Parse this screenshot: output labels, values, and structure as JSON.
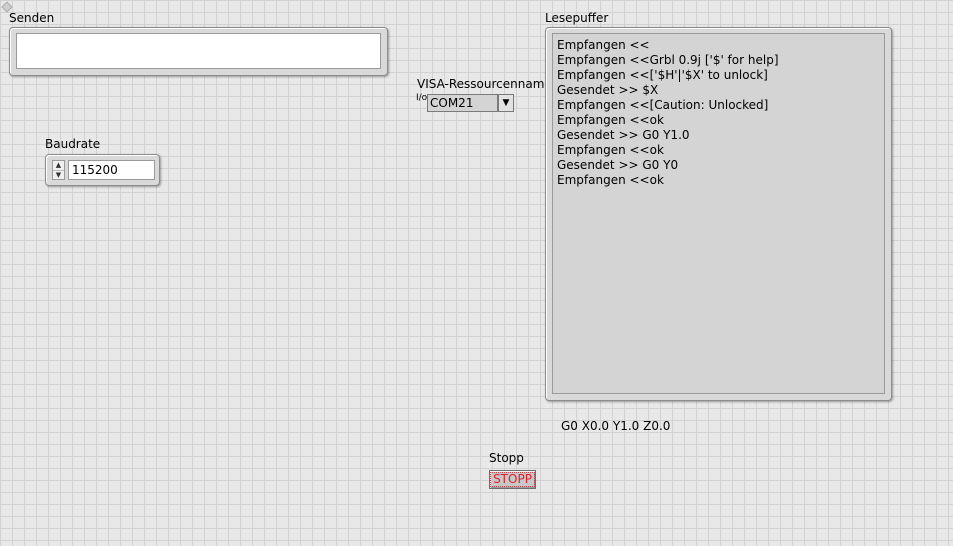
{
  "senden": {
    "label": "Senden",
    "value": ""
  },
  "lesepuffer": {
    "label": "Lesepuffer",
    "lines": [
      "Empfangen <<",
      "Empfangen <<Grbl 0.9j ['$' for help]",
      "Empfangen <<['$H'|'$X' to unlock]",
      "Gesendet >> $X",
      "Empfangen <<[Caution: Unlocked]",
      "Empfangen <<ok",
      "Gesendet >> G0 Y1.0",
      "Empfangen <<ok",
      "Gesendet >> G0 Y0",
      "Empfangen <<ok"
    ]
  },
  "visa": {
    "label": "VISA-Ressourcenname",
    "icon_glyph": "I/o",
    "value": "COM21",
    "arrow_glyph": "▼"
  },
  "baudrate": {
    "label": "Baudrate",
    "value": "115200",
    "up_glyph": "▲",
    "down_glyph": "▼"
  },
  "position_readout": "G0 X0.0 Y1.0 Z0.0",
  "stopp": {
    "label": "Stopp",
    "button_text": "STOPP"
  }
}
